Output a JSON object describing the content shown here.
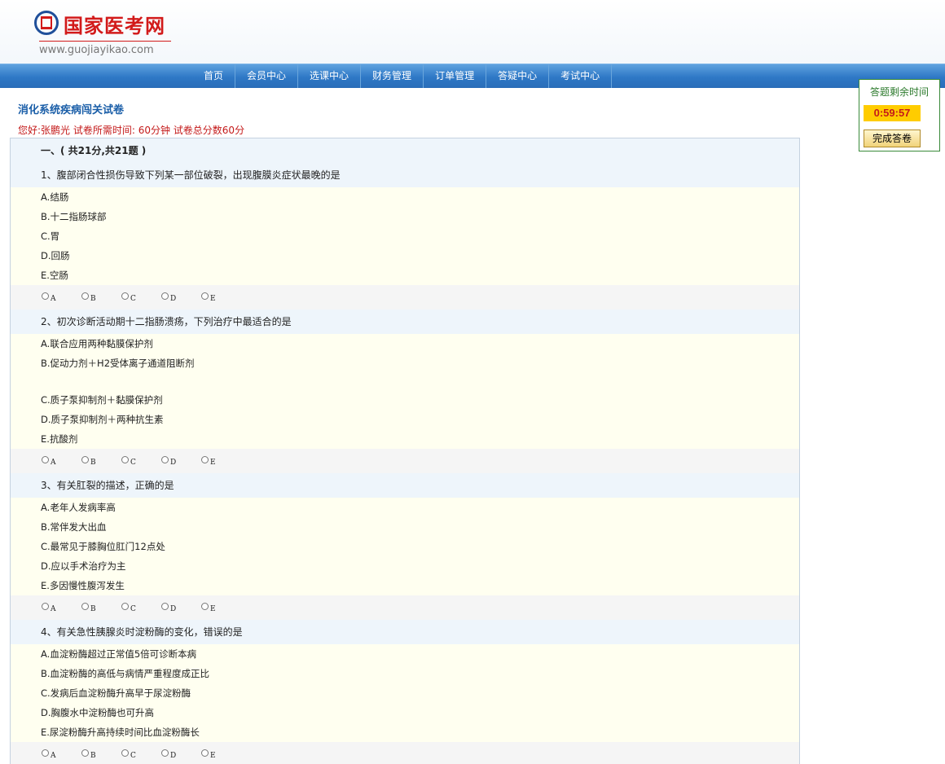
{
  "header": {
    "logo_name": "国家医考网",
    "logo_url": "www.guojiayikao.com"
  },
  "nav": {
    "items": [
      "首页",
      "会员中心",
      "选课中心",
      "财务管理",
      "订单管理",
      "答疑中心",
      "考试中心"
    ]
  },
  "exam": {
    "title": "消化系统疾病闯关试卷",
    "info": "您好:张鹏光   试卷所需时间: 60分钟  试卷总分数60分",
    "section_head": "一、( 共21分,共21题 )",
    "answer_letters": [
      "A",
      "B",
      "C",
      "D",
      "E"
    ],
    "questions": [
      {
        "stem": "1、腹部闭合性损伤导致下列某一部位破裂，出现腹膜炎症状最晚的是",
        "options": [
          "A.结肠",
          "B.十二指肠球部",
          "C.胃",
          "D.回肠",
          "E.空肠"
        ]
      },
      {
        "stem": "2、初次诊断活动期十二指肠溃疡，下列治疗中最适合的是",
        "options": [
          "A.联合应用两种黏膜保护剂",
          "B.促动力剂＋H2受体离子通道阻断剂",
          "C.质子泵抑制剂＋黏膜保护剂",
          "D.质子泵抑制剂＋两种抗生素",
          "E.抗酸剂"
        ]
      },
      {
        "stem": "3、有关肛裂的描述，正确的是",
        "options": [
          "A.老年人发病率高",
          "B.常伴发大出血",
          "C.最常见于膝胸位肛门12点处",
          "D.应以手术治疗为主",
          "E.多因慢性腹泻发生"
        ]
      },
      {
        "stem": "4、有关急性胰腺炎时淀粉酶的变化，错误的是",
        "options": [
          "A.血淀粉酶超过正常值5倍可诊断本病",
          "B.血淀粉酶的高低与病情严重程度成正比",
          "C.发病后血淀粉酶升高早于尿淀粉酶",
          "D.胸腹水中淀粉酶也可升高",
          "E.尿淀粉酶升高持续时间比血淀粉酶长"
        ]
      }
    ]
  },
  "timer": {
    "label": "答题剩余时间",
    "value": "0:59:57",
    "finish_label": "完成答卷"
  },
  "colors": {
    "nav_blue": "#2e78c6",
    "title_blue": "#1a5ea8",
    "info_red": "#c41a1a",
    "timer_yellow": "#ffcc00",
    "stem_bg": "#eef5fb",
    "option_bg": "#fffff0"
  }
}
